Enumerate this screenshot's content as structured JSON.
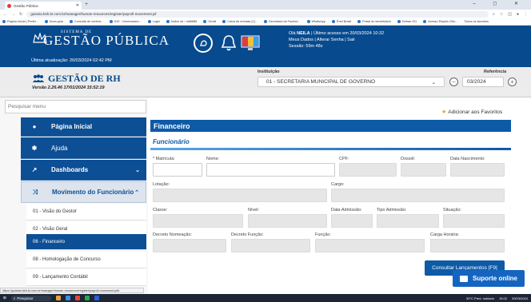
{
  "browser": {
    "tab_title": "Gestão Pública",
    "new_tab": "+",
    "window_controls": "– ◻ ✕",
    "url": "goiania.bsh.br.com.br/manager/human-resources/register/payroll-movement.jsf",
    "bookmarks": [
      "Página Inicial | Prefei...",
      "Nova guia",
      "Consulta de contrat...",
      "IDD - Gerenciador...",
      "Login",
      "Índice de / rs86888",
      "Gmail",
      "Caixa de entrada (2)...",
      "Secretaria da Fazend...",
      "WhatsApp",
      "Ênel Brasil",
      "Portal do beneficiário",
      "Detran GO",
      "Acesso Rápido Citiz...",
      "Todos os favoritos"
    ]
  },
  "header": {
    "logo_small": "SISTEMA DE",
    "logo_big": "GESTÃO PÚBLICA",
    "last_update": "Última atualização: 20/03/2024 02:42 PM",
    "greeting_prefix": "Olá ",
    "user_name": "NEILA",
    "greeting_suffix": " | Último acesso em 20/03/2024 10:32",
    "links": "Meus Dados | Alterar Senha | Sair",
    "session": "Sessão: 59m 48s"
  },
  "rh": {
    "title": "GESTÃO DE RH",
    "version": "Versão 2.26.46 17/01/2024 15:52:19",
    "institution_label": "Instituição",
    "institution_value": "01 - SECRETARIA MUNICIPAL DE GOVERNO",
    "reference_label": "Referência",
    "reference_value": "03/2024"
  },
  "sidebar": {
    "search_placeholder": "Pesquisar menu",
    "items": [
      {
        "label": "Página Inicial",
        "icon": "●"
      },
      {
        "label": "Ajuda",
        "icon": "✱"
      },
      {
        "label": "Dashboards",
        "icon": "↗"
      },
      {
        "label": "Movimento do Funcionário",
        "icon": "⤨"
      }
    ],
    "subitems": [
      "01 - Visão do Gestor",
      "02 - Visão Geral",
      "06 - Financeiro",
      "08 - Homologação de Concurso",
      "09 - Lançamento Contábil"
    ]
  },
  "content": {
    "favorites": "Adicionar aos Favoritos",
    "section": "Financeiro",
    "subsection": "Funcionário",
    "labels": {
      "matricula": "* Matrícula:",
      "nome": "Nome:",
      "cpf": "CPF:",
      "dossie": "Dossiê:",
      "nascimento": "Data Nascimento:",
      "lotacao": "Lotação:",
      "cargo": "Cargo:",
      "classe": "Classe:",
      "nivel": "Nível:",
      "admissao": "Data Admissão:",
      "tipo_admissao": "Tipo Admissão:",
      "situacao": "Situação:",
      "decreto_nomeacao": "Decreto Nomeação:",
      "decreto_funcao": "Decreto Função:",
      "funcao": "Função:",
      "carga": "Carga Horária:"
    },
    "consult_button": "Consultar Lançamentos [F9]",
    "support": "Suporte online"
  },
  "status_url": "https://goiania.bsh.br.com.br/manager/human-resources/register/payroll-movement.jsf#",
  "taskbar": {
    "search": "Pesquisar",
    "weather": "30°C  Pred. nublado",
    "time": "15:02",
    "date": "20/03/2024"
  }
}
